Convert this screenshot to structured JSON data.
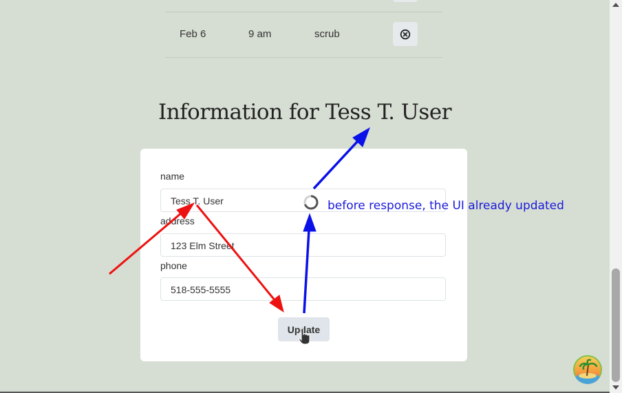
{
  "schedule": {
    "row": {
      "date": "Feb 6",
      "time": "9 am",
      "activity": "scrub"
    }
  },
  "info": {
    "heading": "Information for Tess T. User"
  },
  "form": {
    "name_label": "name",
    "name_value": "Tess T. User",
    "address_label": "address",
    "address_value": "123 Elm Street",
    "phone_label": "phone",
    "phone_value": "518-555-5555",
    "update_label": "Update"
  },
  "annotation": {
    "text": "before response, the UI already updated"
  },
  "colors": {
    "background": "#d6ddd2",
    "annotation_blue": "#1a1adb",
    "arrow_red": "#ee1111",
    "arrow_blue": "#0a10e8"
  }
}
